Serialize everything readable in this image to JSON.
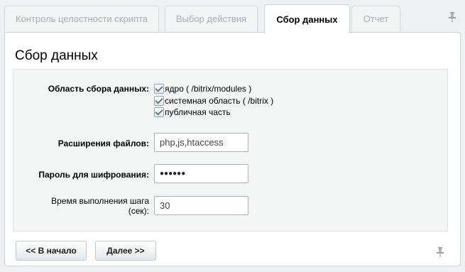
{
  "tabs": [
    {
      "label": "Контроль целостности скрипта",
      "active": false
    },
    {
      "label": "Выбор действия",
      "active": false
    },
    {
      "label": "Сбор данных",
      "active": true
    },
    {
      "label": "Отчет",
      "active": false
    }
  ],
  "panel": {
    "title": "Сбор данных",
    "scope_label": "Область сбора данных:",
    "scope_options": [
      {
        "label": "ядро ( /bitrix/modules )",
        "checked": true
      },
      {
        "label": "системная область ( /bitrix )",
        "checked": true
      },
      {
        "label": "публичная часть",
        "checked": true
      }
    ],
    "extensions_label": "Расширения файлов:",
    "extensions_value": "php,js,htaccess",
    "password_label": "Пароль для шифрования:",
    "password_value": "●●●●●●",
    "step_time_label_line1": "Время выполнения шага",
    "step_time_label_line2": "(сек):",
    "step_time_value": "30"
  },
  "buttons": {
    "back": "<< В начало",
    "next": "Далее >>"
  },
  "icons": {
    "pin": "pin-icon"
  }
}
